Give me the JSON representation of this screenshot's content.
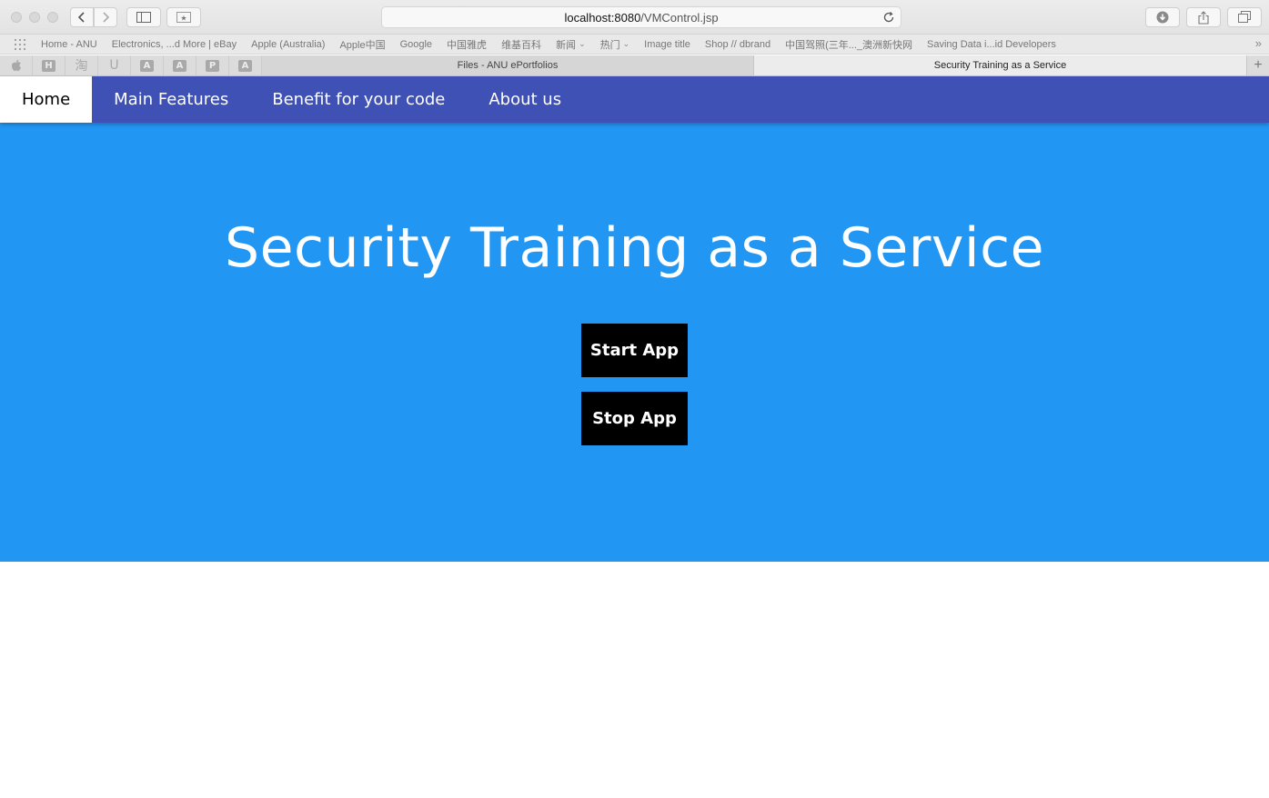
{
  "browser": {
    "url_host": "localhost:8080",
    "url_path": "/VMControl.jsp",
    "bookmarks": [
      {
        "label": "Home - ANU"
      },
      {
        "label": "Electronics, ...d More | eBay"
      },
      {
        "label": "Apple (Australia)"
      },
      {
        "label": "Apple中国"
      },
      {
        "label": "Google"
      },
      {
        "label": "中国雅虎"
      },
      {
        "label": "维基百科"
      },
      {
        "label": "新闻"
      },
      {
        "label": "热门"
      },
      {
        "label": "Image title"
      },
      {
        "label": "Shop // dbrand"
      },
      {
        "label": "中国驾照(三年..._澳洲新快网"
      },
      {
        "label": "Saving Data i...id Developers"
      }
    ],
    "pinned_tabs": [
      {
        "icon": "apple-icon",
        "glyph": ""
      },
      {
        "icon": "h-icon",
        "glyph": "H"
      },
      {
        "icon": "taobao-icon",
        "glyph": "淘"
      },
      {
        "icon": "u-icon",
        "glyph": "U"
      },
      {
        "icon": "a-icon",
        "glyph": "A"
      },
      {
        "icon": "a-icon",
        "glyph": "A"
      },
      {
        "icon": "p-icon",
        "glyph": "P"
      },
      {
        "icon": "a-icon",
        "glyph": "A"
      }
    ],
    "tabs": [
      {
        "title": "Files - ANU ePortfolios",
        "active": false
      },
      {
        "title": "Security Training as a Service",
        "active": true
      }
    ]
  },
  "nav": {
    "items": [
      {
        "label": "Home",
        "active": true
      },
      {
        "label": "Main Features",
        "active": false
      },
      {
        "label": "Benefit for your code",
        "active": false
      },
      {
        "label": "About us",
        "active": false
      }
    ]
  },
  "hero": {
    "title": "Security Training as a Service",
    "start_label": "Start App",
    "stop_label": "Stop App"
  },
  "colors": {
    "nav_bg": "#3f51b5",
    "hero_bg": "#2196f3",
    "button_bg": "#000000"
  }
}
